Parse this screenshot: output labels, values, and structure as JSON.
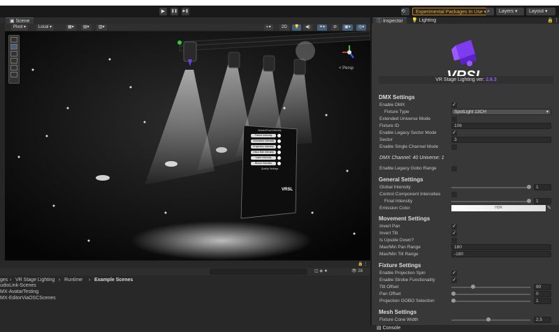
{
  "toolbar": {
    "play": "▶",
    "pause": "❚❚",
    "step": "▶❚",
    "experimental_label": "Experimental Packages In Use ▾",
    "layers_label": "Layers",
    "layout_label": "Layout"
  },
  "scene": {
    "tab_label": "Scene",
    "pivot_label": "Pivot",
    "local_label": "Local",
    "mode_2d": "2D",
    "persp_label": "< Persp",
    "panel_title": "Master/Final Intensity",
    "panel_items": [
      "Fixture Intensity",
      "Volumetric Intensity",
      "Projection Intensity",
      "Disco Ball Intensity",
      "Laser Intensity",
      "Bloom Intensity"
    ],
    "panel_quality": "Quality Settings",
    "panel_logo": "VRSL"
  },
  "project": {
    "breadcrumb": [
      "ges",
      "VR Stage Lighting",
      "Runtime",
      "Example Scenes"
    ],
    "files": [
      "udioLink-Scenes",
      "MX-AvatarTesting",
      "MX-EditorViaOSCScenes"
    ],
    "count": "28"
  },
  "inspector": {
    "tab_inspector": "Inspector",
    "tab_lighting": "Lighting",
    "logo_text": "VRSL",
    "version_label": "VR Stage Lighting ver:",
    "version_value": "2.6.3",
    "dmx": {
      "title": "DMX Settings",
      "enable_dmx": "Enable DMX",
      "fixture_type": "Fixture Type",
      "fixture_type_value": "SpotLight 13CH",
      "extended_universe": "Extended Universe Mode",
      "fixture_id": "Fixture ID",
      "fixture_id_value": "106",
      "legacy_sector": "Enable Legacy Sector Mode",
      "sector": "Sector",
      "sector_value": "3",
      "single_channel": "Enable Single Channel Mode",
      "channel_info": "DMX Channel: 40   Universe: 1",
      "legacy_gobo": "Enable Legacy Gobo Range"
    },
    "general": {
      "title": "General Settings",
      "global_intensity": "Global Intensity",
      "global_intensity_value": "1",
      "control_component": "Control Component Intensities",
      "final_intensity": "Final Intensity",
      "final_intensity_value": "1",
      "emission_color": "Emission Color",
      "emission_hdr": "HDR"
    },
    "movement": {
      "title": "Movement Settings",
      "invert_pan": "Invert Pan",
      "invert_tilt": "Invert Tilt",
      "upside_down": "Is Upside Down?",
      "pan_range": "Max/Min Pan Range",
      "pan_range_value": "180",
      "tilt_range": "Max/Min Tilt Range",
      "tilt_range_value": "-180"
    },
    "fixture": {
      "title": "Fixture Settings",
      "projection_spin": "Enable Projection Spin",
      "strobe": "Enable Strobe Functionality",
      "tilt_offset": "Tilt Offset",
      "tilt_offset_value": "90",
      "pan_offset": "Pan Offset",
      "pan_offset_value": "0",
      "gobo_selection": "Projection GOBO Selection",
      "gobo_selection_value": "1"
    },
    "mesh": {
      "title": "Mesh Settings",
      "cone_width": "Fixture Cone Width",
      "cone_width_value": "2.5"
    },
    "accent": "#9b59ff"
  },
  "console": {
    "tab_label": "Console"
  }
}
